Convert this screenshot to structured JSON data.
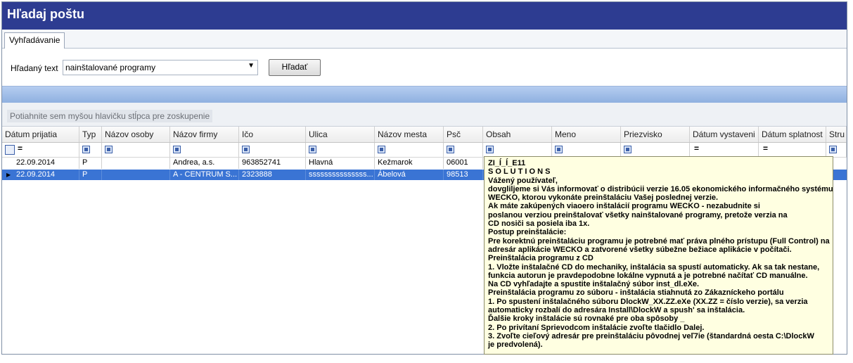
{
  "window": {
    "title": "Hľadaj poštu"
  },
  "tabs": [
    {
      "label": "Vyhľadávanie"
    }
  ],
  "search": {
    "label": "Hľadaný text",
    "value": "nainštalované programy",
    "button": "Hľadať"
  },
  "group_panel": {
    "hint": "Potiahnite sem myšou hlavičku stĺpca pre zoskupenie"
  },
  "grid": {
    "columns": [
      "Dátum prijatia",
      "Typ",
      "Názov osoby",
      "Názov firmy",
      "Ičo",
      "Ulica",
      "Názov mesta",
      "Psč",
      "Obsah",
      "Meno",
      "Priezvisko",
      "Dátum vystaveni",
      "Dátum splatnost",
      "Stru"
    ],
    "filter_eq": "=",
    "rows": [
      [
        "22.09.2014",
        "P",
        "",
        "Andrea, a.s.",
        "963852741",
        "Hlavná",
        "Kežmarok",
        "06001",
        "",
        "",
        "",
        "",
        "",
        ""
      ],
      [
        "22.09.2014",
        "P",
        "",
        "A - CENTRUM S...",
        "2323888",
        "sssssssssssssss...",
        "Ábelová",
        "98513",
        "",
        "",
        "",
        "",
        "",
        ""
      ]
    ]
  },
  "tooltip": {
    "lines": [
      "ZI_Í_Í_E11",
      "S O L U T I O N S",
      "Vážený používateľ,",
      "dovgliljeme si Vás informovať o distribúcii verzie 16.05 ekonomického informačného systému",
      "WECKO, ktorou vykonáte preinštaláciu Vašej poslednej verzie.",
      "Ak máte zakúpených viaoero inštalácií programu WECKO - nezabudnite si",
      "poslanou verziou preinštalovať všetky nainštalované programy, pretože verzia na",
      "CD nosiči sa posiela iba 1x.",
      "Postup preinštalácie:",
      "Pre korektnú preinštaláciu programu je potrebné mať práva plného prístupu (Full Control) na",
      "adresár aplikácie WECKO a zatvorené všetky súbežne bežiace aplikácie v počítači.",
      "Preinštalácia programu z CD",
      "1. Vložte inštalačné CD do mechaniky, inštalácia sa spustí automaticky. Ak sa tak nestane,",
      "funkcia autorun je pravdepodobne lokálne vypnutá a je potrebné načítať CD manuálne.",
      "Na CD vyhľadajte a spustite inštalačný súbor inst_dl.eXe.",
      "Preinštalácia programu zo súboru - inštalácia stiahnutá zo Zákazníckeho portálu",
      "1. Po spustení inštalačného súboru DlockW_XX.ZZ.eXe (XX.ZZ = číslo verzie), sa verzia",
      "  automaticky rozbalí do adresára Install\\DlockW a spush' sa inštalácia.",
      "Ďalšie kroky inštalácie sú rovnaké pre oba spôsoby _",
      "2. Po privítaní Sprievodcom inštalácie zvoľte tlačidlo Dalej.",
      "3. Zvoľte cieľový adresár pre preinštaláciu pôvodnej veľ7ie (štandardná oesta C:\\DlockW",
      "je predvolená)."
    ]
  }
}
